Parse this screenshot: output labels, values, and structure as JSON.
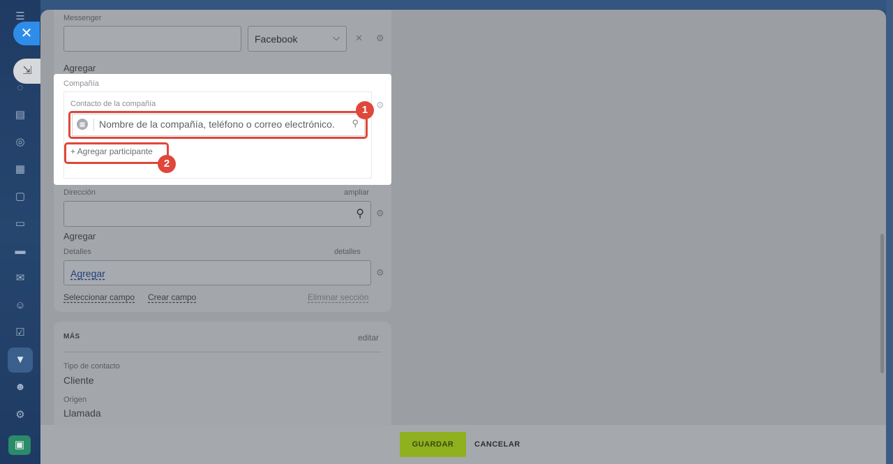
{
  "sidebar": {
    "icons": [
      "menu-icon",
      "chat-icon",
      "feed-icon",
      "target-icon",
      "calendar-icon",
      "document-icon",
      "presentation-icon",
      "card-icon",
      "mail-icon",
      "contacts-icon",
      "tasks-icon",
      "crm-funnel-icon",
      "robot-icon",
      "settings-icon",
      "printer-icon"
    ]
  },
  "form": {
    "messenger_label": "Messenger",
    "messenger_value": "",
    "messenger_type": "Facebook",
    "messenger_add": "Agregar",
    "company_section_label": "Compañía",
    "company_contact_label": "Contacto de la compañía",
    "company_search_placeholder": "Nombre de la compañía, teléfono o correo electrónico.",
    "add_participant": "+ Agregar participante",
    "address_label": "Dirección",
    "address_expand": "ampliar",
    "address_add": "Agregar",
    "details_label": "Detalles",
    "details_link": "detalles",
    "details_add": "Agregar",
    "select_field": "Seleccionar campo",
    "create_field": "Crear campo",
    "delete_section": "Eliminar sección"
  },
  "more": {
    "title": "MÁS",
    "edit": "editar",
    "contact_type_label": "Tipo de contacto",
    "contact_type_value": "Cliente",
    "source_label": "Origen",
    "source_value": "Llamada"
  },
  "annotations": {
    "badge1": "1",
    "badge2": "2"
  },
  "footer": {
    "save": "GUARDAR",
    "cancel": "CANCELAR"
  },
  "colors": {
    "accent_red": "#e0463a",
    "save_green": "#8fb01f",
    "close_blue": "#2e8de8"
  }
}
